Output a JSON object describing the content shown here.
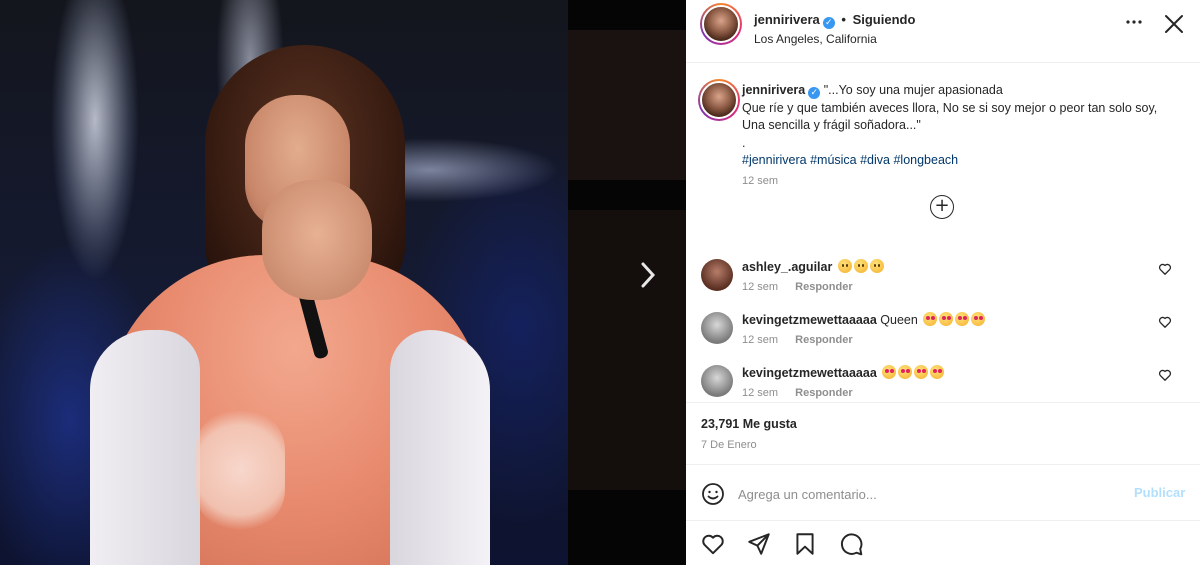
{
  "media": {
    "next_icon": "chevron-right-icon"
  },
  "header": {
    "username": "jennirivera",
    "separator": "•",
    "follow_status": "Siguiendo",
    "location": "Los Angeles, California",
    "more_icon": "more-horizontal-icon",
    "close_icon": "close-icon"
  },
  "caption": {
    "username": "jennirivera",
    "lines": [
      "\"...Yo soy una mujer apasionada",
      "Que ríe y que también aveces llora, No se si soy mejor o peor tan solo soy, Una sencilla y frágil soñadora...\"",
      "."
    ],
    "hashtags": "#jennirivera #música #diva #longbeach",
    "time": "12 sem",
    "load_more_icon": "plus-circle-icon"
  },
  "comments": [
    {
      "username": "ashley_.aguilar",
      "text": "",
      "emojis": [
        "worried",
        "worried",
        "worried"
      ],
      "time": "12 sem",
      "reply": "Responder"
    },
    {
      "username": "kevingetzmewettaaaaa",
      "text": "Queen",
      "emojis": [
        "hearteyes",
        "hearteyes",
        "hearteyes",
        "hearteyes"
      ],
      "time": "12 sem",
      "reply": "Responder"
    },
    {
      "username": "kevingetzmewettaaaaa",
      "text": "",
      "emojis": [
        "hearteyes",
        "hearteyes",
        "hearteyes",
        "hearteyes"
      ],
      "time": "12 sem",
      "reply": "Responder"
    }
  ],
  "stats": {
    "likes": "23,791 Me gusta",
    "date": "7 De Enero"
  },
  "add_comment": {
    "placeholder": "Agrega un comentario...",
    "publish": "Publicar"
  },
  "actions": [
    "heart-icon",
    "send-icon",
    "bookmark-icon",
    "comment-icon"
  ],
  "colors": {
    "link": "#00376b",
    "verified": "#3897f0",
    "publish_disabled": "#b2dffc",
    "muted": "#8e8e8e"
  }
}
